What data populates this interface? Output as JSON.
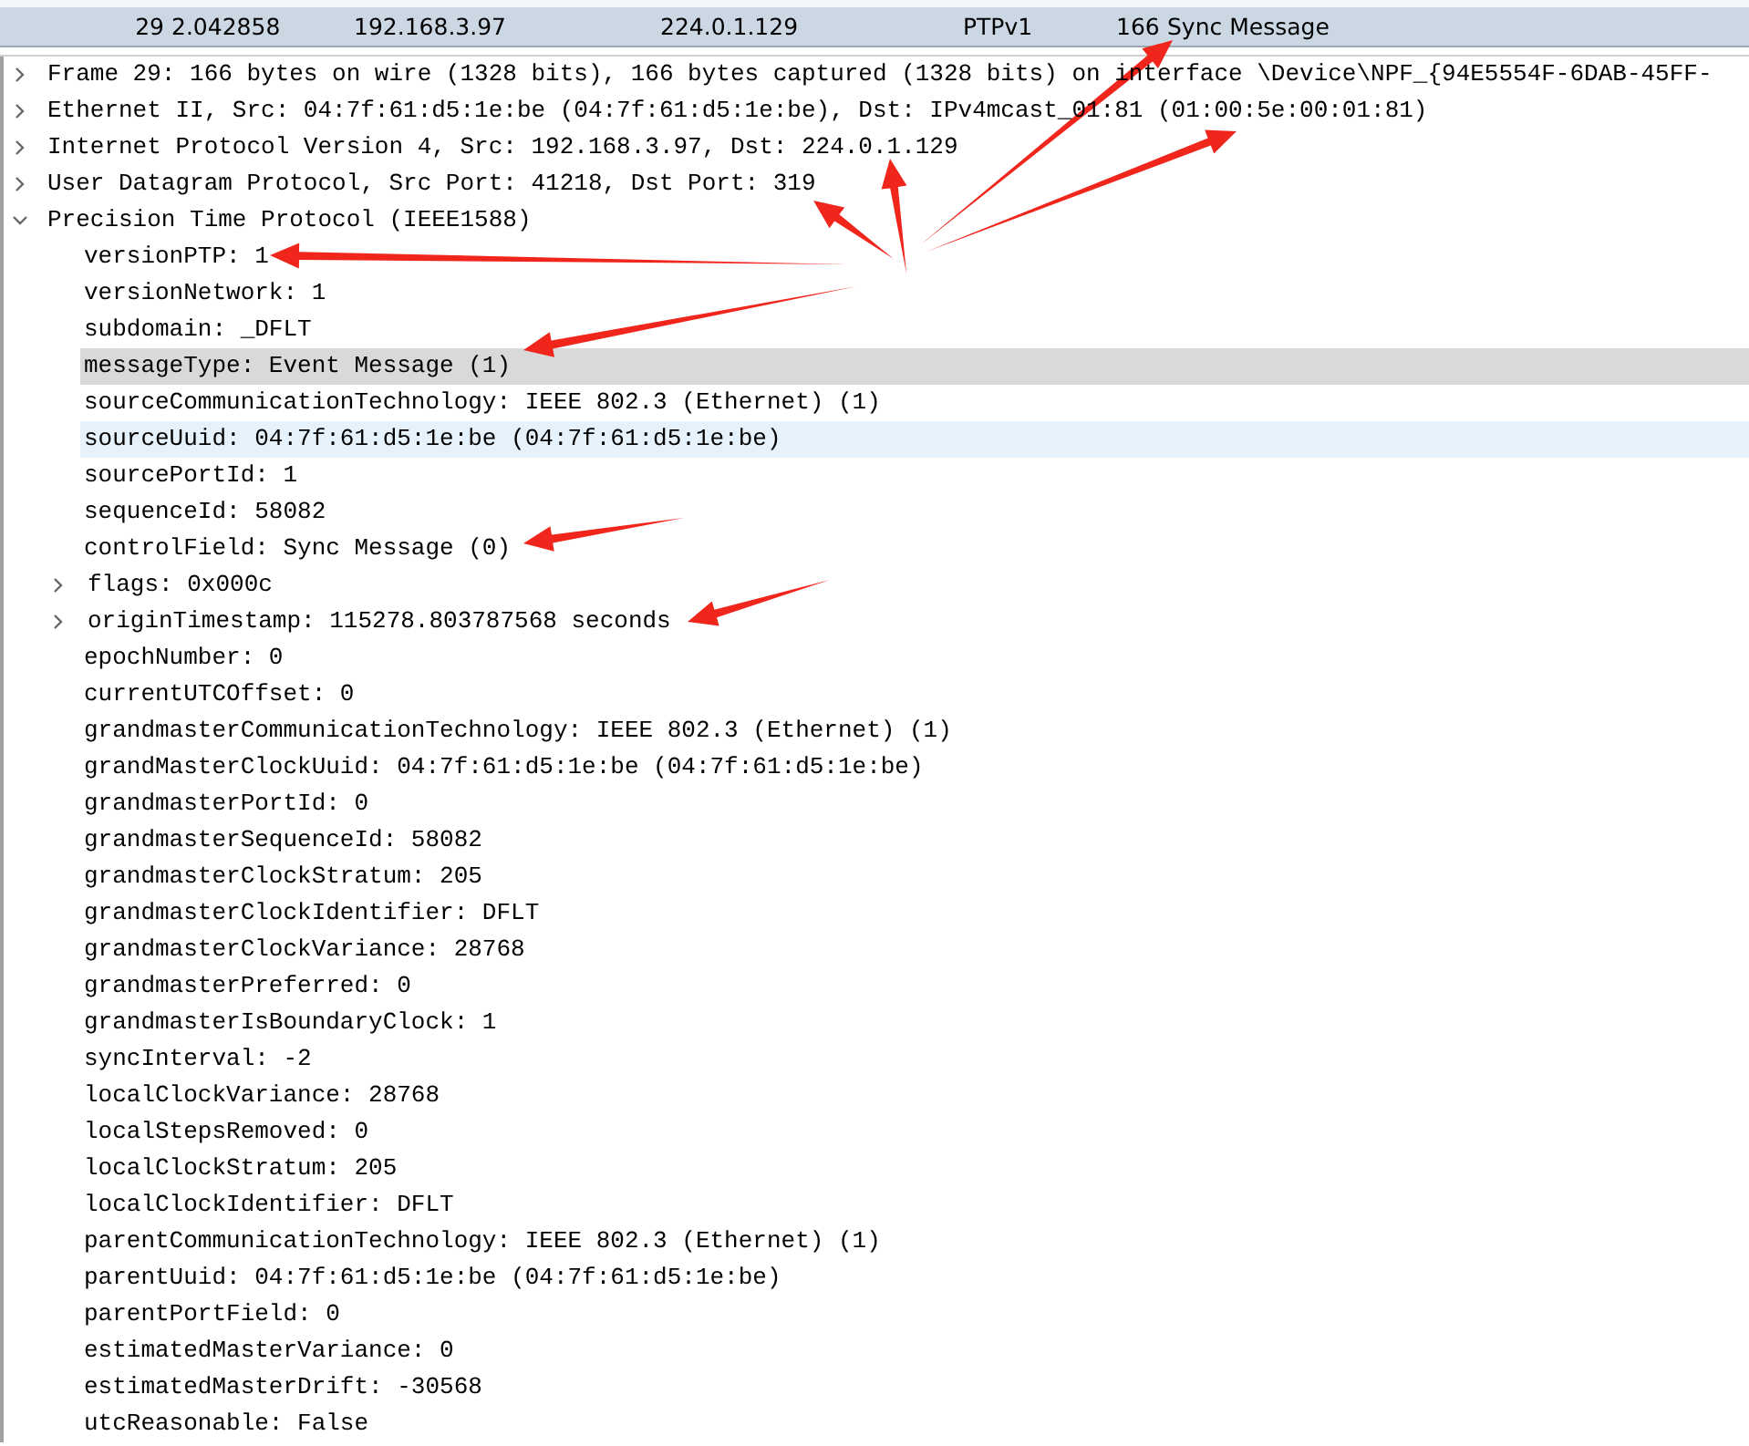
{
  "packet_row": {
    "number": "29",
    "time": "2.042858",
    "source": "192.168.3.97",
    "destination": "224.0.1.129",
    "protocol": "PTPv1",
    "length": "166",
    "info": "Sync Message",
    "selected": true
  },
  "tree": [
    {
      "label": "Frame 29: 166 bytes on wire (1328 bits), 166 bytes captured (1328 bits) on interface \\Device\\NPF_{94E5554F-6DAB-45FF-",
      "expanded": false
    },
    {
      "label": "Ethernet II, Src: 04:7f:61:d5:1e:be (04:7f:61:d5:1e:be), Dst: IPv4mcast_01:81 (01:00:5e:00:01:81)",
      "expanded": false
    },
    {
      "label": "Internet Protocol Version 4, Src: 192.168.3.97, Dst: 224.0.1.129",
      "expanded": false
    },
    {
      "label": "User Datagram Protocol, Src Port: 41218, Dst Port: 319",
      "expanded": false
    },
    {
      "label": "Precision Time Protocol (IEEE1588)",
      "expanded": true,
      "children": [
        {
          "label": "versionPTP: 1",
          "kind": "leaf",
          "selected": false,
          "highlighted": false
        },
        {
          "label": "versionNetwork: 1",
          "kind": "leaf",
          "selected": false,
          "highlighted": false
        },
        {
          "label": "subdomain: _DFLT",
          "kind": "leaf",
          "selected": false,
          "highlighted": false
        },
        {
          "label": "messageType: Event Message (1)",
          "kind": "leaf",
          "selected": true,
          "highlighted": false
        },
        {
          "label": "sourceCommunicationTechnology: IEEE 802.3 (Ethernet) (1)",
          "kind": "leaf",
          "selected": false,
          "highlighted": false
        },
        {
          "label": "sourceUuid: 04:7f:61:d5:1e:be (04:7f:61:d5:1e:be)",
          "kind": "leaf",
          "selected": false,
          "highlighted": true
        },
        {
          "label": "sourcePortId: 1",
          "kind": "leaf",
          "selected": false,
          "highlighted": false
        },
        {
          "label": "sequenceId: 58082",
          "kind": "leaf",
          "selected": false,
          "highlighted": false
        },
        {
          "label": "controlField: Sync Message (0)",
          "kind": "leaf",
          "selected": false,
          "highlighted": false
        },
        {
          "label": "flags: 0x000c",
          "kind": "branch",
          "selected": false,
          "highlighted": false
        },
        {
          "label": "originTimestamp: 115278.803787568 seconds",
          "kind": "branch",
          "selected": false,
          "highlighted": false
        },
        {
          "label": "epochNumber: 0",
          "kind": "leaf",
          "selected": false,
          "highlighted": false
        },
        {
          "label": "currentUTCOffset: 0",
          "kind": "leaf",
          "selected": false,
          "highlighted": false
        },
        {
          "label": "grandmasterCommunicationTechnology: IEEE 802.3 (Ethernet) (1)",
          "kind": "leaf",
          "selected": false,
          "highlighted": false
        },
        {
          "label": "grandMasterClockUuid: 04:7f:61:d5:1e:be (04:7f:61:d5:1e:be)",
          "kind": "leaf",
          "selected": false,
          "highlighted": false
        },
        {
          "label": "grandmasterPortId: 0",
          "kind": "leaf",
          "selected": false,
          "highlighted": false
        },
        {
          "label": "grandmasterSequenceId: 58082",
          "kind": "leaf",
          "selected": false,
          "highlighted": false
        },
        {
          "label": "grandmasterClockStratum: 205",
          "kind": "leaf",
          "selected": false,
          "highlighted": false
        },
        {
          "label": "grandmasterClockIdentifier: DFLT",
          "kind": "leaf",
          "selected": false,
          "highlighted": false
        },
        {
          "label": "grandmasterClockVariance: 28768",
          "kind": "leaf",
          "selected": false,
          "highlighted": false
        },
        {
          "label": "grandmasterPreferred: 0",
          "kind": "leaf",
          "selected": false,
          "highlighted": false
        },
        {
          "label": "grandmasterIsBoundaryClock: 1",
          "kind": "leaf",
          "selected": false,
          "highlighted": false
        },
        {
          "label": "syncInterval: -2",
          "kind": "leaf",
          "selected": false,
          "highlighted": false
        },
        {
          "label": "localClockVariance: 28768",
          "kind": "leaf",
          "selected": false,
          "highlighted": false
        },
        {
          "label": "localStepsRemoved: 0",
          "kind": "leaf",
          "selected": false,
          "highlighted": false
        },
        {
          "label": "localClockStratum: 205",
          "kind": "leaf",
          "selected": false,
          "highlighted": false
        },
        {
          "label": "localClockIdentifier: DFLT",
          "kind": "leaf",
          "selected": false,
          "highlighted": false
        },
        {
          "label": "parentCommunicationTechnology: IEEE 802.3 (Ethernet) (1)",
          "kind": "leaf",
          "selected": false,
          "highlighted": false
        },
        {
          "label": "parentUuid: 04:7f:61:d5:1e:be (04:7f:61:d5:1e:be)",
          "kind": "leaf",
          "selected": false,
          "highlighted": false
        },
        {
          "label": "parentPortField: 0",
          "kind": "leaf",
          "selected": false,
          "highlighted": false
        },
        {
          "label": "estimatedMasterVariance: 0",
          "kind": "leaf",
          "selected": false,
          "highlighted": false
        },
        {
          "label": "estimatedMasterDrift: -30568",
          "kind": "leaf",
          "selected": false,
          "highlighted": false
        },
        {
          "label": "utcReasonable: False",
          "kind": "leaf",
          "selected": false,
          "highlighted": false
        }
      ]
    }
  ]
}
